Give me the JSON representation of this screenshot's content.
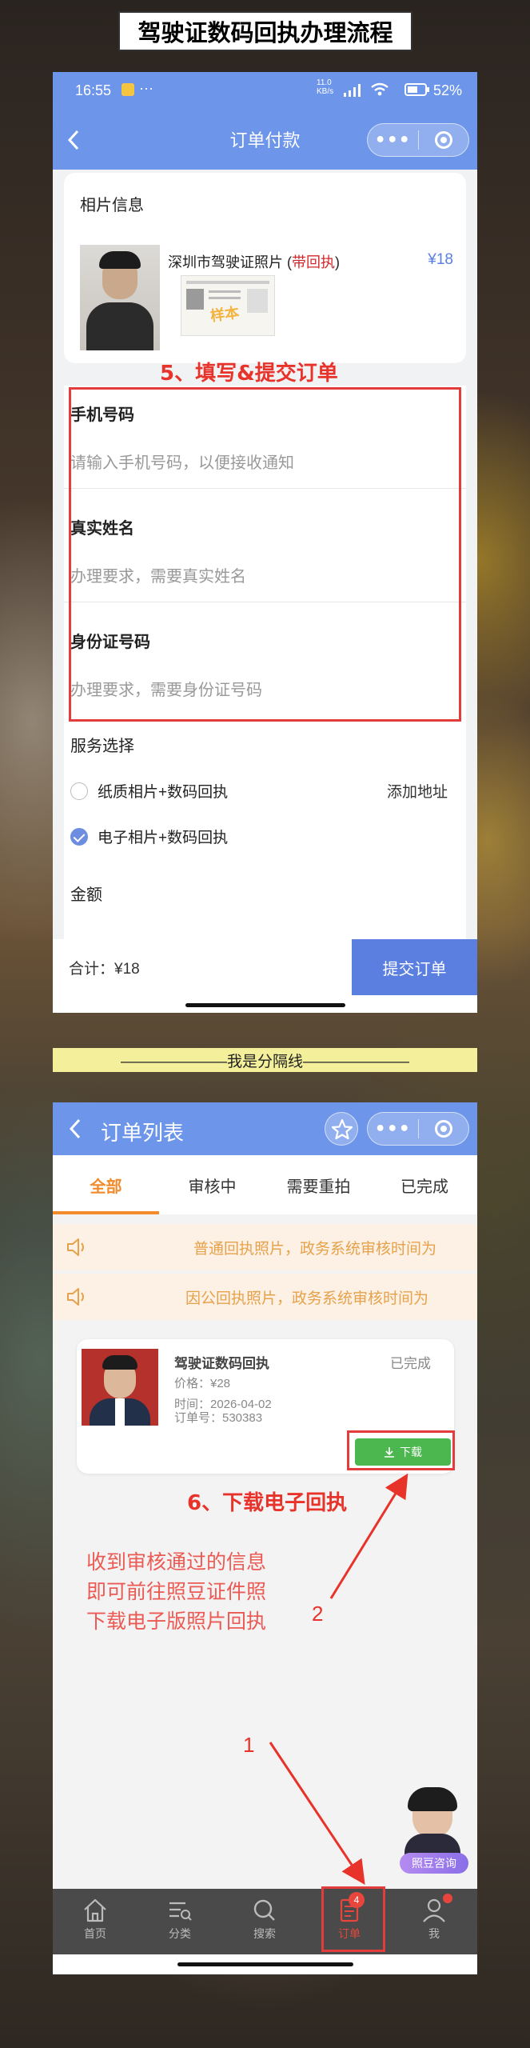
{
  "page_title": "驾驶证数码回执办理流程",
  "phone1": {
    "status": {
      "time": "16:55",
      "extra": "···",
      "net": "11.0 KB/s",
      "battery": "52%"
    },
    "nav_title": "订单付款",
    "capsule_dots": "•••",
    "photo_section_title": "相片信息",
    "product": {
      "name_prefix": "深圳市驾驶证照片 (",
      "name_highlight": "带回执",
      "name_suffix": ")",
      "price": "¥18",
      "stamp": "样本"
    },
    "step5": "5、填写&提交订单",
    "fields": [
      {
        "label": "手机号码",
        "placeholder": "请输入手机号码，以便接收通知"
      },
      {
        "label": "真实姓名",
        "placeholder": "办理要求，需要真实姓名"
      },
      {
        "label": "身份证号码",
        "placeholder": "办理要求，需要身份证号码"
      }
    ],
    "service_title": "服务选择",
    "service_options": [
      {
        "label": "纸质相片+数码回执",
        "checked": false,
        "action": "添加地址"
      },
      {
        "label": "电子相片+数码回执",
        "checked": true
      }
    ],
    "amount_title": "金额",
    "total": "合计：¥18",
    "submit": "提交订单"
  },
  "divider_text": "———————我是分隔线———————",
  "phone2": {
    "nav_title": "订单列表",
    "tabs": [
      "全部",
      "审核中",
      "需要重拍",
      "已完成"
    ],
    "active_tab": 0,
    "notices": [
      "普通回执照片，政务系统审核时间为",
      "因公回执照片，政务系统审核时间为"
    ],
    "order": {
      "title": "驾驶证数码回执",
      "status": "已完成",
      "price": "价格：¥28",
      "time": "时间：2026-04-02",
      "order_no": "订单号：530383",
      "download": "下载"
    },
    "step6": "6、下载电子回执",
    "instruction": [
      "收到审核通过的信息",
      "即可前往照豆证件照",
      "下载电子版照片回执"
    ],
    "arrow_labels": [
      "1",
      "2"
    ],
    "consult": "照豆咨询",
    "tabbar": [
      {
        "label": "首页",
        "icon": "home-icon"
      },
      {
        "label": "分类",
        "icon": "category-icon"
      },
      {
        "label": "搜索",
        "icon": "search-icon"
      },
      {
        "label": "订单",
        "icon": "order-icon",
        "badge": "4",
        "active": true
      },
      {
        "label": "我",
        "icon": "profile-icon",
        "dot": true
      }
    ]
  },
  "colors": {
    "nav_blue": "#6d95e9",
    "submit_blue": "#5a7fe0",
    "accent_orange": "#f28b2c",
    "annotation_red": "#e8332b",
    "download_green": "#4cb74f"
  }
}
